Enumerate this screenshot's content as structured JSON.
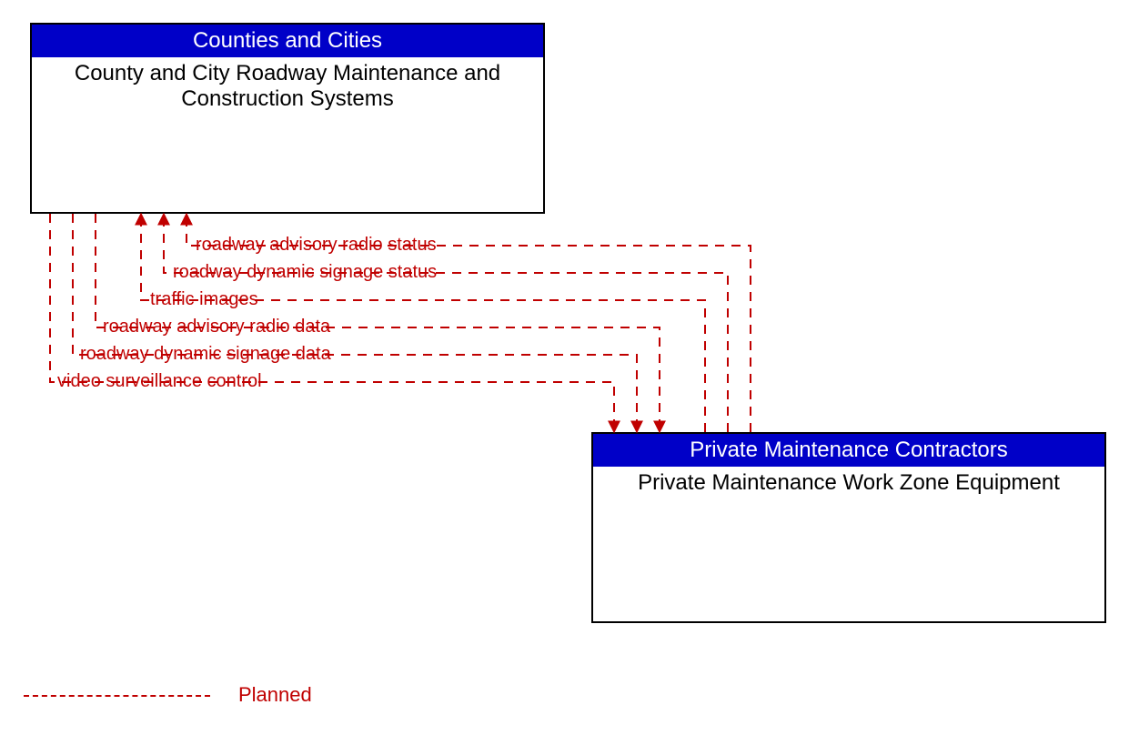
{
  "boxes": {
    "top": {
      "header": "Counties and Cities",
      "body": "County and City Roadway Maintenance and Construction Systems"
    },
    "bottom": {
      "header": "Private Maintenance Contractors",
      "body": "Private Maintenance Work Zone Equipment"
    }
  },
  "flows": {
    "to_bottom": [
      "video surveillance control",
      "roadway dynamic signage data",
      "roadway advisory radio data"
    ],
    "to_top": [
      "traffic images",
      "roadway dynamic signage status",
      "roadway advisory radio status"
    ]
  },
  "legend": {
    "planned": "Planned"
  },
  "colors": {
    "header_bg": "#0000c8",
    "flow": "#c00000"
  }
}
